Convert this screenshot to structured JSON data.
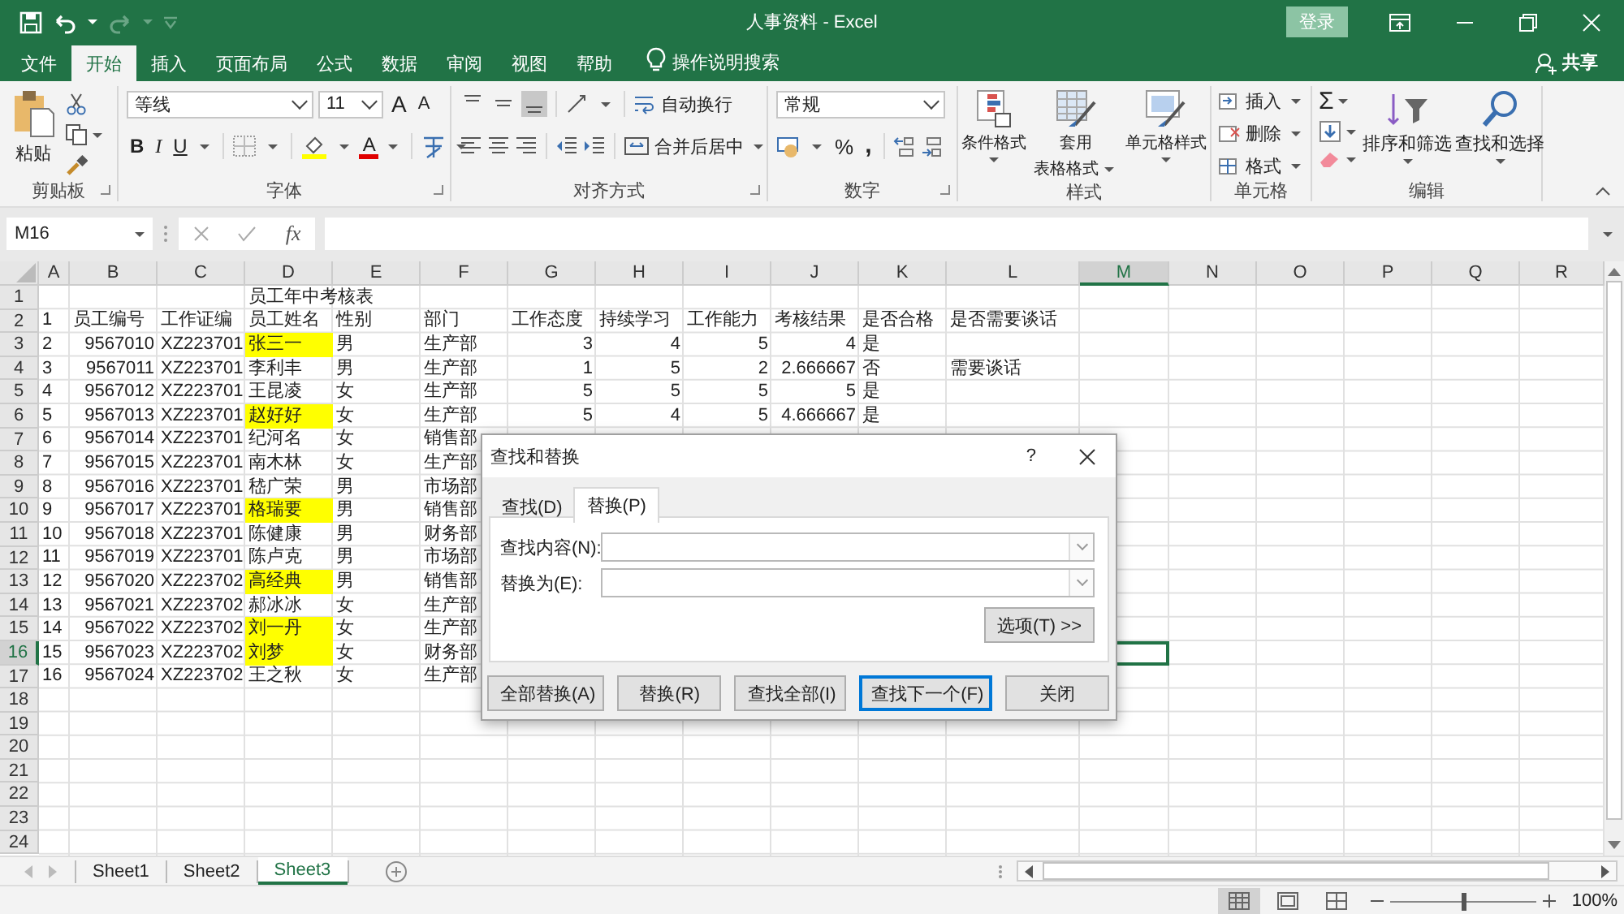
{
  "title_bar": {
    "title": "人事资料 - Excel",
    "login": "登录"
  },
  "menu_tabs": [
    {
      "label": "文件",
      "selected": false
    },
    {
      "label": "开始",
      "selected": true
    },
    {
      "label": "插入",
      "selected": false
    },
    {
      "label": "页面布局",
      "selected": false
    },
    {
      "label": "公式",
      "selected": false
    },
    {
      "label": "数据",
      "selected": false
    },
    {
      "label": "审阅",
      "selected": false
    },
    {
      "label": "视图",
      "selected": false
    },
    {
      "label": "帮助",
      "selected": false
    }
  ],
  "tell_me": "操作说明搜索",
  "share": "共享",
  "ribbon": {
    "clipboard": {
      "paste": "粘贴",
      "label": "剪贴板"
    },
    "font": {
      "name": "等线",
      "size": "11",
      "grow": "A",
      "shrink": "A",
      "bold": "B",
      "italic": "I",
      "underline": "U",
      "color_letter": "A",
      "label": "字体"
    },
    "alignment": {
      "vertical_align": [
        {
          "selected": false
        },
        {
          "selected": false
        },
        {
          "selected": true
        }
      ],
      "wrap": "自动换行",
      "merge": "合并后居中",
      "label": "对齐方式"
    },
    "number": {
      "format": "常规",
      "percent": "%",
      "comma": ",",
      "label": "数字"
    },
    "styles": {
      "conditional": "条件格式",
      "table_1": "套用",
      "table_2": "表格格式",
      "cell_styles": "单元格样式",
      "label": "样式"
    },
    "cells": {
      "items": [
        "插入",
        "删除",
        "格式"
      ],
      "label": "单元格"
    },
    "editing": {
      "sum": "Σ",
      "sort": "排序和筛选",
      "find": "查找和选择",
      "label": "编辑"
    }
  },
  "formula_bar": {
    "name_box": "M16",
    "fx": "fx"
  },
  "sheet": {
    "columns": [
      {
        "label": "A",
        "selected": false
      },
      {
        "label": "B",
        "selected": false
      },
      {
        "label": "C",
        "selected": false
      },
      {
        "label": "D",
        "selected": false
      },
      {
        "label": "E",
        "selected": false
      },
      {
        "label": "F",
        "selected": false
      },
      {
        "label": "G",
        "selected": false
      },
      {
        "label": "H",
        "selected": false
      },
      {
        "label": "I",
        "selected": false
      },
      {
        "label": "J",
        "selected": false
      },
      {
        "label": "K",
        "selected": false
      },
      {
        "label": "L",
        "selected": false
      },
      {
        "label": "M",
        "selected": true
      },
      {
        "label": "N",
        "selected": false
      },
      {
        "label": "O",
        "selected": false
      },
      {
        "label": "P",
        "selected": false
      },
      {
        "label": "Q",
        "selected": false
      },
      {
        "label": "R",
        "selected": false
      }
    ],
    "rows": [
      {
        "number": "1",
        "selected": false,
        "cells": [
          null,
          null,
          null,
          {
            "text": "员工年中考核表",
            "kind": "text"
          }
        ]
      },
      {
        "number": "2",
        "selected": false,
        "cells": [
          {
            "text": "1",
            "kind": "text"
          },
          {
            "text": "员工编号",
            "kind": "text"
          },
          {
            "text": "工作证编",
            "kind": "text"
          },
          {
            "text": "员工姓名",
            "kind": "text"
          },
          {
            "text": "性别",
            "kind": "text"
          },
          {
            "text": "部门",
            "kind": "text"
          },
          {
            "text": "工作态度",
            "kind": "text"
          },
          {
            "text": "持续学习",
            "kind": "text"
          },
          {
            "text": "工作能力",
            "kind": "text"
          },
          {
            "text": "考核结果",
            "kind": "text"
          },
          {
            "text": "是否合格",
            "kind": "text"
          },
          {
            "text": "是否需要谈话",
            "kind": "text"
          }
        ]
      },
      {
        "number": "3",
        "selected": false,
        "cells": [
          {
            "text": "2",
            "kind": "text"
          },
          {
            "text": "9567010",
            "kind": "number"
          },
          {
            "text": "XZ223701",
            "kind": "text"
          },
          {
            "text": "张三一",
            "kind": "text",
            "highlighted": true
          },
          {
            "text": "男",
            "kind": "text"
          },
          {
            "text": "生产部",
            "kind": "text"
          },
          {
            "text": "3",
            "kind": "number"
          },
          {
            "text": "4",
            "kind": "number"
          },
          {
            "text": "5",
            "kind": "number"
          },
          {
            "text": "4",
            "kind": "number"
          },
          {
            "text": "是",
            "kind": "text"
          }
        ]
      },
      {
        "number": "4",
        "selected": false,
        "cells": [
          {
            "text": "3",
            "kind": "text"
          },
          {
            "text": "9567011",
            "kind": "number"
          },
          {
            "text": "XZ223701",
            "kind": "text"
          },
          {
            "text": "李利丰",
            "kind": "text",
            "highlighted": false
          },
          {
            "text": "男",
            "kind": "text"
          },
          {
            "text": "生产部",
            "kind": "text"
          },
          {
            "text": "1",
            "kind": "number"
          },
          {
            "text": "5",
            "kind": "number"
          },
          {
            "text": "2",
            "kind": "number"
          },
          {
            "text": "2.666667",
            "kind": "number"
          },
          {
            "text": "否",
            "kind": "text"
          },
          {
            "text": "需要谈话",
            "kind": "text"
          }
        ]
      },
      {
        "number": "5",
        "selected": false,
        "cells": [
          {
            "text": "4",
            "kind": "text"
          },
          {
            "text": "9567012",
            "kind": "number"
          },
          {
            "text": "XZ223701",
            "kind": "text"
          },
          {
            "text": "王昆凌",
            "kind": "text",
            "highlighted": false
          },
          {
            "text": "女",
            "kind": "text"
          },
          {
            "text": "生产部",
            "kind": "text"
          },
          {
            "text": "5",
            "kind": "number"
          },
          {
            "text": "5",
            "kind": "number"
          },
          {
            "text": "5",
            "kind": "number"
          },
          {
            "text": "5",
            "kind": "number"
          },
          {
            "text": "是",
            "kind": "text"
          }
        ]
      },
      {
        "number": "6",
        "selected": false,
        "cells": [
          {
            "text": "5",
            "kind": "text"
          },
          {
            "text": "9567013",
            "kind": "number"
          },
          {
            "text": "XZ223701",
            "kind": "text"
          },
          {
            "text": "赵好好",
            "kind": "text",
            "highlighted": true
          },
          {
            "text": "女",
            "kind": "text"
          },
          {
            "text": "生产部",
            "kind": "text"
          },
          {
            "text": "5",
            "kind": "number"
          },
          {
            "text": "4",
            "kind": "number"
          },
          {
            "text": "5",
            "kind": "number"
          },
          {
            "text": "4.666667",
            "kind": "number"
          },
          {
            "text": "是",
            "kind": "text"
          }
        ]
      },
      {
        "number": "7",
        "selected": false,
        "cells": [
          {
            "text": "6",
            "kind": "text"
          },
          {
            "text": "9567014",
            "kind": "number"
          },
          {
            "text": "XZ223701",
            "kind": "text"
          },
          {
            "text": "纪河名",
            "kind": "text",
            "highlighted": false
          },
          {
            "text": "女",
            "kind": "text"
          },
          {
            "text": "销售部",
            "kind": "text"
          }
        ]
      },
      {
        "number": "8",
        "selected": false,
        "cells": [
          {
            "text": "7",
            "kind": "text"
          },
          {
            "text": "9567015",
            "kind": "number"
          },
          {
            "text": "XZ223701",
            "kind": "text"
          },
          {
            "text": "南木林",
            "kind": "text",
            "highlighted": false
          },
          {
            "text": "女",
            "kind": "text"
          },
          {
            "text": "生产部",
            "kind": "text"
          }
        ]
      },
      {
        "number": "9",
        "selected": false,
        "cells": [
          {
            "text": "8",
            "kind": "text"
          },
          {
            "text": "9567016",
            "kind": "number"
          },
          {
            "text": "XZ223701",
            "kind": "text"
          },
          {
            "text": "嵇广荣",
            "kind": "text",
            "highlighted": false
          },
          {
            "text": "男",
            "kind": "text"
          },
          {
            "text": "市场部",
            "kind": "text"
          }
        ]
      },
      {
        "number": "10",
        "selected": false,
        "cells": [
          {
            "text": "9",
            "kind": "text"
          },
          {
            "text": "9567017",
            "kind": "number"
          },
          {
            "text": "XZ223701",
            "kind": "text"
          },
          {
            "text": "格瑞要",
            "kind": "text",
            "highlighted": true
          },
          {
            "text": "男",
            "kind": "text"
          },
          {
            "text": "销售部",
            "kind": "text"
          }
        ]
      },
      {
        "number": "11",
        "selected": false,
        "cells": [
          {
            "text": "10",
            "kind": "text"
          },
          {
            "text": "9567018",
            "kind": "number"
          },
          {
            "text": "XZ223701",
            "kind": "text"
          },
          {
            "text": "陈健康",
            "kind": "text",
            "highlighted": false
          },
          {
            "text": "男",
            "kind": "text"
          },
          {
            "text": "财务部",
            "kind": "text"
          }
        ]
      },
      {
        "number": "12",
        "selected": false,
        "cells": [
          {
            "text": "11",
            "kind": "text"
          },
          {
            "text": "9567019",
            "kind": "number"
          },
          {
            "text": "XZ223701",
            "kind": "text"
          },
          {
            "text": "陈卢克",
            "kind": "text",
            "highlighted": false
          },
          {
            "text": "男",
            "kind": "text"
          },
          {
            "text": "市场部",
            "kind": "text"
          }
        ]
      },
      {
        "number": "13",
        "selected": false,
        "cells": [
          {
            "text": "12",
            "kind": "text"
          },
          {
            "text": "9567020",
            "kind": "number"
          },
          {
            "text": "XZ223702",
            "kind": "text"
          },
          {
            "text": "高经典",
            "kind": "text",
            "highlighted": true
          },
          {
            "text": "男",
            "kind": "text"
          },
          {
            "text": "销售部",
            "kind": "text"
          }
        ]
      },
      {
        "number": "14",
        "selected": false,
        "cells": [
          {
            "text": "13",
            "kind": "text"
          },
          {
            "text": "9567021",
            "kind": "number"
          },
          {
            "text": "XZ223702",
            "kind": "text"
          },
          {
            "text": "郝冰冰",
            "kind": "text",
            "highlighted": false
          },
          {
            "text": "女",
            "kind": "text"
          },
          {
            "text": "生产部",
            "kind": "text"
          }
        ]
      },
      {
        "number": "15",
        "selected": false,
        "cells": [
          {
            "text": "14",
            "kind": "text"
          },
          {
            "text": "9567022",
            "kind": "number"
          },
          {
            "text": "XZ223702",
            "kind": "text"
          },
          {
            "text": "刘一丹",
            "kind": "text",
            "highlighted": true
          },
          {
            "text": "女",
            "kind": "text"
          },
          {
            "text": "生产部",
            "kind": "text"
          }
        ]
      },
      {
        "number": "16",
        "selected": true,
        "cells": [
          {
            "text": "15",
            "kind": "text"
          },
          {
            "text": "9567023",
            "kind": "number"
          },
          {
            "text": "XZ223702",
            "kind": "text"
          },
          {
            "text": "刘梦",
            "kind": "text",
            "highlighted": true
          },
          {
            "text": "女",
            "kind": "text"
          },
          {
            "text": "财务部",
            "kind": "text"
          }
        ]
      },
      {
        "number": "17",
        "selected": false,
        "cells": [
          {
            "text": "16",
            "kind": "text"
          },
          {
            "text": "9567024",
            "kind": "number"
          },
          {
            "text": "XZ223702",
            "kind": "text"
          },
          {
            "text": "王之秋",
            "kind": "text",
            "highlighted": false
          },
          {
            "text": "女",
            "kind": "text"
          },
          {
            "text": "生产部",
            "kind": "text"
          }
        ]
      },
      {
        "number": "18",
        "selected": false
      },
      {
        "number": "19",
        "selected": false
      },
      {
        "number": "20",
        "selected": false
      },
      {
        "number": "21",
        "selected": false
      },
      {
        "number": "22",
        "selected": false
      },
      {
        "number": "23",
        "selected": false
      },
      {
        "number": "24",
        "selected": false
      }
    ]
  },
  "dialog": {
    "title": "查找和替换",
    "help": "?",
    "tabs": [
      {
        "label": "查找(D)",
        "selected": false
      },
      {
        "label": "替换(P)",
        "selected": true
      }
    ],
    "fields": [
      {
        "label": "查找内容(N):"
      },
      {
        "label": "替换为(E):"
      }
    ],
    "options": "选项(T) >>",
    "buttons": [
      {
        "label": "全部替换(A)",
        "default": false
      },
      {
        "label": "替换(R)",
        "default": false
      },
      {
        "label": "查找全部(I)",
        "default": false
      },
      {
        "label": "查找下一个(F)",
        "default": true
      },
      {
        "label": "关闭",
        "default": false
      }
    ]
  },
  "sheet_tabs": [
    {
      "label": "Sheet1",
      "selected": false
    },
    {
      "label": "Sheet2",
      "selected": false
    },
    {
      "label": "Sheet3",
      "selected": true
    }
  ],
  "status_bar": {
    "views": [
      {
        "selected": true
      },
      {
        "selected": false
      },
      {
        "selected": false
      }
    ],
    "zoom": {
      "level": 0.5
    },
    "zoom_text": "100%"
  }
}
